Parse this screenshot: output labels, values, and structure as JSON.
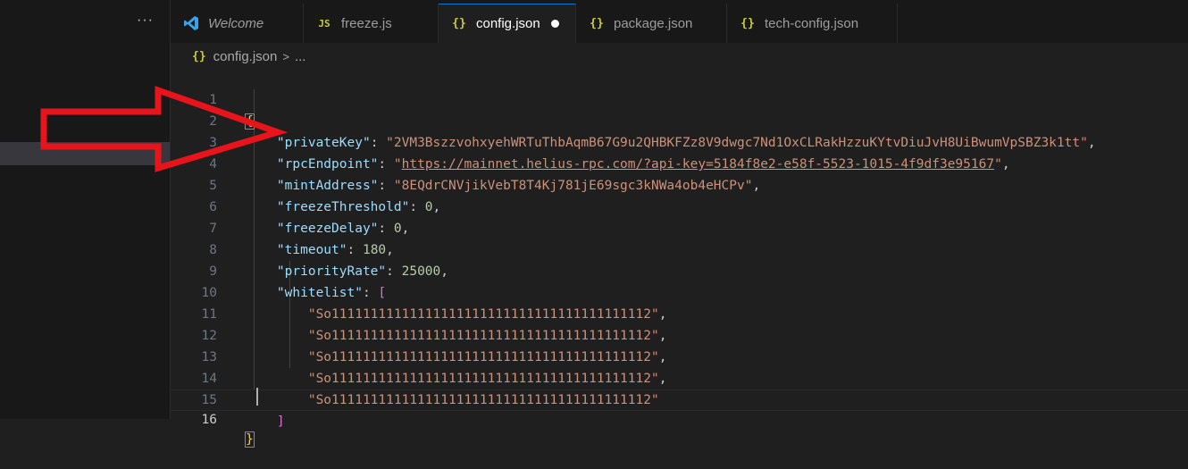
{
  "sidebar": {
    "more_label": "···"
  },
  "tabs": [
    {
      "label": "Welcome",
      "icon": "vscode-logo-icon",
      "italic": true
    },
    {
      "label": "freeze.js",
      "icon": "js-file-icon",
      "icon_text": "JS"
    },
    {
      "label": "config.json",
      "icon": "json-file-icon",
      "icon_text": "{}",
      "active": true,
      "modified": true
    },
    {
      "label": "package.json",
      "icon": "json-file-icon",
      "icon_text": "{}"
    },
    {
      "label": "tech-config.json",
      "icon": "json-file-icon",
      "icon_text": "{}"
    }
  ],
  "breadcrumb": {
    "icon_text": "{}",
    "file": "config.json",
    "separator": ">",
    "more": "..."
  },
  "editor": {
    "line_numbers": [
      "1",
      "2",
      "3",
      "4",
      "5",
      "6",
      "7",
      "8",
      "9",
      "10",
      "11",
      "12",
      "13",
      "14",
      "15",
      "16"
    ],
    "active_line": "16",
    "open_brace": "{",
    "close_brace": "}",
    "lines": [
      {
        "key": "\"privateKey\"",
        "colon": ": ",
        "value": "\"2VM3BszzvohxyehWRTuThbAqmB67G9u2QHBKFZz8V9dwgc7Nd1OxCLRakHzzuKYtvDiuJvH8UiBwumVpSBZ3k1tt\"",
        "trail": ","
      },
      {
        "key": "\"rpcEndpoint\"",
        "colon": ": ",
        "q1": "\"",
        "url": "https://mainnet.helius-rpc.com/?api-key=5184f8e2-e58f-5523-1015-4f9df3e95167",
        "q2": "\"",
        "trail": ","
      },
      {
        "key": "\"mintAddress\"",
        "colon": ": ",
        "value": "\"8EQdrCNVjikVebT8T4Kj781jE69sgc3kNWa4ob4eHCPv\"",
        "trail": ","
      },
      {
        "key": "\"freezeThreshold\"",
        "colon": ": ",
        "num": "0",
        "trail": ","
      },
      {
        "key": "\"freezeDelay\"",
        "colon": ": ",
        "num": "0",
        "trail": ","
      },
      {
        "key": "\"timeout\"",
        "colon": ": ",
        "num": "180",
        "trail": ","
      },
      {
        "key": "\"priorityRate\"",
        "colon": ": ",
        "num": "25000",
        "trail": ","
      },
      {
        "key": "\"whitelist\"",
        "colon": ": ",
        "bracket": "["
      }
    ],
    "whitelist": [
      {
        "value": "\"So11111111111111111111111111111111111111112\"",
        "trail": ","
      },
      {
        "value": "\"So11111111111111111111111111111111111111112\"",
        "trail": ","
      },
      {
        "value": "\"So11111111111111111111111111111111111111112\"",
        "trail": ","
      },
      {
        "value": "\"So11111111111111111111111111111111111111112\"",
        "trail": ","
      },
      {
        "value": "\"So11111111111111111111111111111111111111112\"",
        "trail": ""
      }
    ],
    "close_bracket": "]"
  },
  "annotation": {
    "color": "#e8141c"
  },
  "colors": {
    "accent": "#0078d4",
    "key": "#9cdcfe",
    "string": "#ce9178",
    "number": "#b5cea8",
    "brace": "#ffd700",
    "bracket": "#da70d6"
  }
}
